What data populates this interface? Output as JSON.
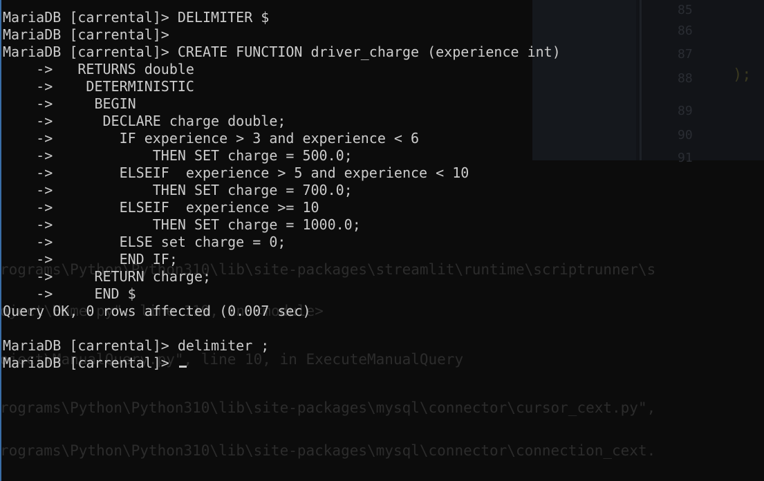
{
  "background_ghost": {
    "line_numbers": [
      "85",
      "86",
      "87",
      "88",
      "89",
      "90",
      "91"
    ],
    "paren": ");",
    "text_lines": [
      "rograms\\Python\\Python310\\lib\\site-packages\\streamlit\\runtime\\scriptrunner\\s",
      "oject\\Home.py\", line 119, in <module>",
      "oject\\ManualQuery.py\", line 10, in ExecuteManualQuery",
      "rograms\\Python\\Python310\\lib\\site-packages\\mysql\\connector\\cursor_cext.py\",",
      "rograms\\Python\\Python310\\lib\\site-packages\\mysql\\connector\\connection_cext."
    ]
  },
  "terminal": {
    "lines": [
      "MariaDB [carrental]> DELIMITER $",
      "MariaDB [carrental]>",
      "MariaDB [carrental]> CREATE FUNCTION driver_charge (experience int)",
      "    ->   RETURNS double",
      "    ->    DETERMINISTIC",
      "    ->     BEGIN",
      "    ->      DECLARE charge double;",
      "    ->        IF experience > 3 and experience < 6",
      "    ->            THEN SET charge = 500.0;",
      "    ->        ELSEIF  experience > 5 and experience < 10",
      "    ->            THEN SET charge = 700.0;",
      "    ->        ELSEIF  experience >= 10",
      "    ->            THEN SET charge = 1000.0;",
      "    ->        ELSE set charge = 0;",
      "    ->        END IF;",
      "    ->     RETURN charge;",
      "    ->     END $",
      "Query OK, 0 rows affected (0.007 sec)",
      "",
      "MariaDB [carrental]> delimiter ;",
      "MariaDB [carrental]> "
    ]
  }
}
